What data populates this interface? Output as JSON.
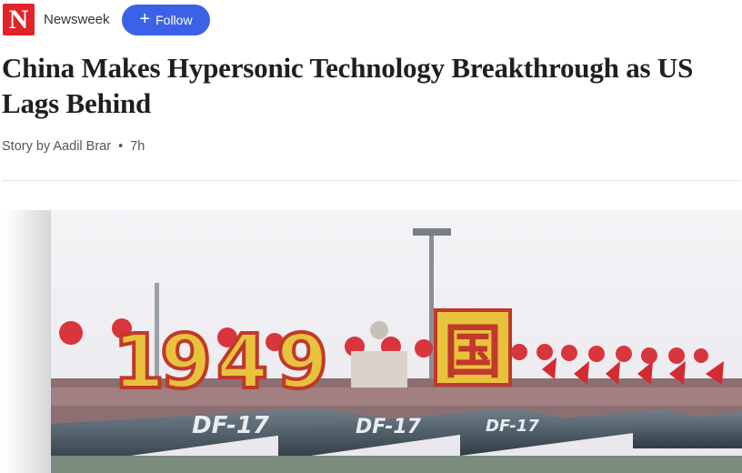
{
  "header": {
    "logo_letter": "N",
    "publisher": "Newsweek",
    "follow_label": "Follow",
    "follow_icon": "plus-icon"
  },
  "article": {
    "title": "China Makes Hypersonic Technology Breakthrough as US Lags Behind",
    "byline": "Story by Aadil Brar",
    "age": "7h"
  },
  "hero_image": {
    "description_text": [
      "1949",
      "国",
      "DF-17",
      "DF-17",
      "DF-17"
    ]
  },
  "colors": {
    "logo_red": "#e2232a",
    "follow_blue": "#3b62e6"
  }
}
